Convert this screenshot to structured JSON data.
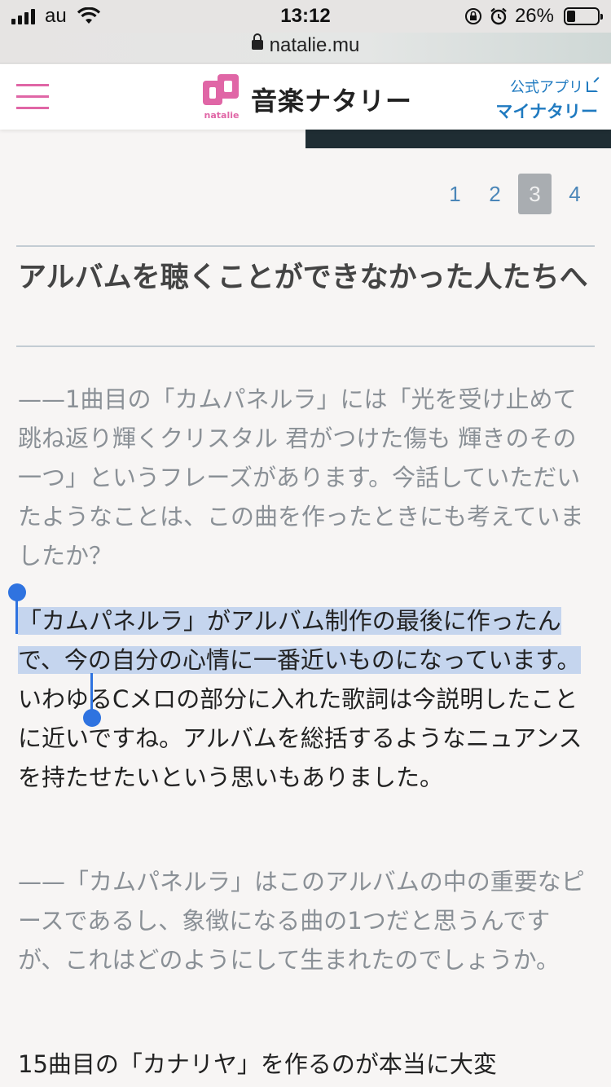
{
  "status_bar": {
    "carrier": "au",
    "time": "13:12",
    "battery": "26%",
    "icons": [
      "signal-icon",
      "wifi-icon",
      "orientation-lock-icon",
      "alarm-icon",
      "battery-icon"
    ]
  },
  "browser": {
    "url": "natalie.mu",
    "icons": [
      "lock-icon"
    ]
  },
  "header": {
    "logo_small": "natalie",
    "title": "音楽ナタリー",
    "app_link_line1": "公式アプリ",
    "app_link_line2": "マイナタリー",
    "brand_color": "#e066a6",
    "link_color": "#1f7ac0"
  },
  "pagination": {
    "pages": [
      "1",
      "2",
      "3",
      "4"
    ],
    "current": "3"
  },
  "article": {
    "heading": "アルバムを聴くことができなかった人たちへ",
    "q1": "——1曲目の「カムパネルラ」には「光を受け止めて 跳ね返り輝くクリスタル 君がつけた傷も 輝きのその一つ」というフレーズがあります。今話していただいたようなことは、この曲を作ったときにも考えていましたか？",
    "a1_selected": "「カムパネルラ」がアルバム制作の最後に作ったんで、今の自分の心情に一番近いものになっています。",
    "a1_rest": "いわゆるCメロの部分に入れた歌詞は今説明したことに近いですね。アルバムを総括するようなニュアンスを持たせたいという思いもありました。",
    "q2": "——「カムパネルラ」はこのアルバムの中の重要なピースであるし、象徴になる曲の1つだと思うんですが、これはどのようにして生まれたのでしょうか。",
    "a2": "15曲目の「カナリヤ」を作るのが本当に大変"
  }
}
